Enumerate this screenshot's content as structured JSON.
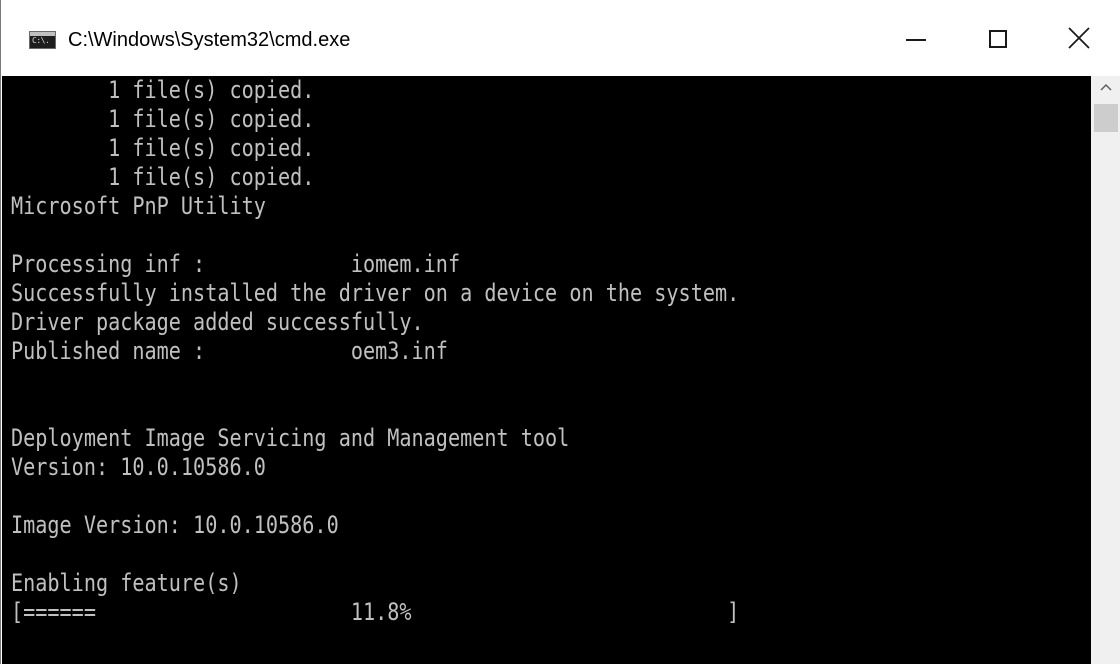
{
  "window": {
    "title": "C:\\Windows\\System32\\cmd.exe",
    "icon": "cmd-icon",
    "icon_label": "C:\\."
  },
  "controls": {
    "minimize_icon": "minimize-icon",
    "maximize_icon": "maximize-icon",
    "close_icon": "close-icon"
  },
  "console": {
    "lines": [
      "        1 file(s) copied.",
      "        1 file(s) copied.",
      "        1 file(s) copied.",
      "        1 file(s) copied.",
      "Microsoft PnP Utility",
      "",
      "Processing inf :            iomem.inf",
      "Successfully installed the driver on a device on the system.",
      "Driver package added successfully.",
      "Published name :            oem3.inf",
      "",
      "",
      "Deployment Image Servicing and Management tool",
      "Version: 10.0.10586.0",
      "",
      "Image Version: 10.0.10586.0",
      "",
      "Enabling feature(s)",
      "[======                     11.8%                          ]"
    ],
    "progress_percent": 11.8
  },
  "colors": {
    "console_bg": "#000000",
    "console_fg": "#c0c0c0",
    "titlebar_bg": "#ffffff",
    "scrollbar_bg": "#f0f0f0"
  }
}
